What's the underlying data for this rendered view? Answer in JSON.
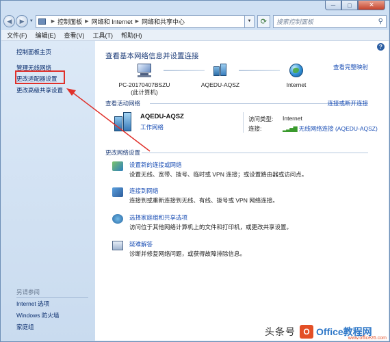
{
  "window": {
    "caption": {
      "minimize": "─",
      "maximize": "□",
      "close": "✕"
    }
  },
  "address": {
    "crumbs": [
      "控制面板",
      "网络和 Internet",
      "网络和共享中心"
    ],
    "search_placeholder": "搜索控制面板"
  },
  "menu": [
    "文件(F)",
    "编辑(E)",
    "查看(V)",
    "工具(T)",
    "帮助(H)"
  ],
  "sidebar": {
    "items": [
      {
        "label": "控制面板主页"
      },
      {
        "label": "管理无线网络"
      },
      {
        "label": "更改适配器设置"
      },
      {
        "label": "更改高级共享设置"
      }
    ],
    "see_also_title": "另请参阅",
    "see_also": [
      {
        "label": "Internet 选项"
      },
      {
        "label": "Windows 防火墙"
      },
      {
        "label": "家庭组"
      }
    ]
  },
  "main": {
    "title": "查看基本网络信息并设置连接",
    "full_map_link": "查看完整映射",
    "map": [
      {
        "name": "PC-20170407BSZU",
        "sub": "(此计算机)"
      },
      {
        "name": "AQEDU-AQSZ",
        "sub": ""
      },
      {
        "name": "Internet",
        "sub": ""
      }
    ],
    "active_title": "查看活动网络",
    "connect_link": "连接或断开连接",
    "active_network": {
      "name": "AQEDU-AQSZ",
      "type": "工作网络",
      "access_label": "访问类型:",
      "access_value": "Internet",
      "conn_label": "连接:",
      "conn_value": "无线网络连接 (AQEDU-AQSZ)"
    },
    "change_title": "更改网络设置",
    "tasks": [
      {
        "link": "设置新的连接或网络",
        "desc": "设置无线、宽带、拨号、临时或 VPN 连接；或设置路由器或访问点。",
        "icon": "network-setup-icon"
      },
      {
        "link": "连接到网络",
        "desc": "连接到或重新连接到无线、有线、拨号或 VPN 网络连接。",
        "icon": "network-connect-icon"
      },
      {
        "link": "选择家庭组和共享选项",
        "desc": "访问位于其他网络计算机上的文件和打印机，或更改共享设置。",
        "icon": "homegroup-icon"
      },
      {
        "link": "疑难解答",
        "desc": "诊断并修复网络问题，或获得故障排除信息。",
        "icon": "troubleshoot-icon"
      }
    ]
  },
  "watermark": {
    "text": "头条号",
    "logo": "O",
    "brand": "Office教程网",
    "site": "www.office26.com"
  },
  "colors": {
    "link": "#1b4fb5",
    "annotation": "#e0302a",
    "pane": "#dce9f7"
  }
}
